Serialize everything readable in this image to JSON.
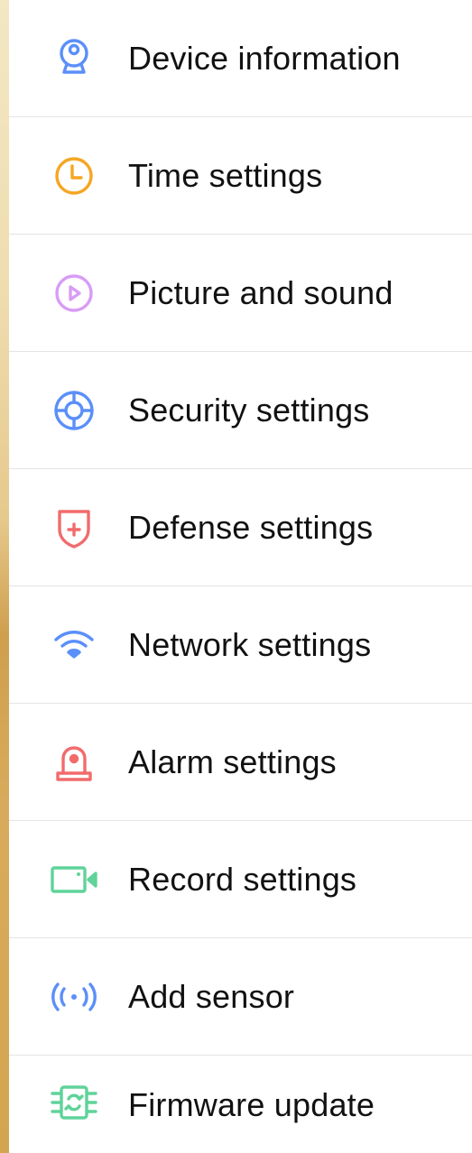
{
  "menu": {
    "items": [
      {
        "label": "Device information",
        "icon": "camera-icon",
        "color": "#5b8ff9"
      },
      {
        "label": "Time settings",
        "icon": "clock-icon",
        "color": "#f5a623"
      },
      {
        "label": "Picture and sound",
        "icon": "play-circle-icon",
        "color": "#d89cf6"
      },
      {
        "label": "Security settings",
        "icon": "crosshair-icon",
        "color": "#5b8ff9"
      },
      {
        "label": "Defense settings",
        "icon": "shield-icon",
        "color": "#f26b6b"
      },
      {
        "label": "Network settings",
        "icon": "wifi-icon",
        "color": "#5b8ff9"
      },
      {
        "label": "Alarm settings",
        "icon": "alarm-light-icon",
        "color": "#f26b6b"
      },
      {
        "label": "Record settings",
        "icon": "video-camera-icon",
        "color": "#5fd39a"
      },
      {
        "label": "Add sensor",
        "icon": "sensor-signal-icon",
        "color": "#5b8ff9"
      },
      {
        "label": "Firmware update",
        "icon": "firmware-chip-icon",
        "color": "#5fd39a"
      }
    ]
  }
}
